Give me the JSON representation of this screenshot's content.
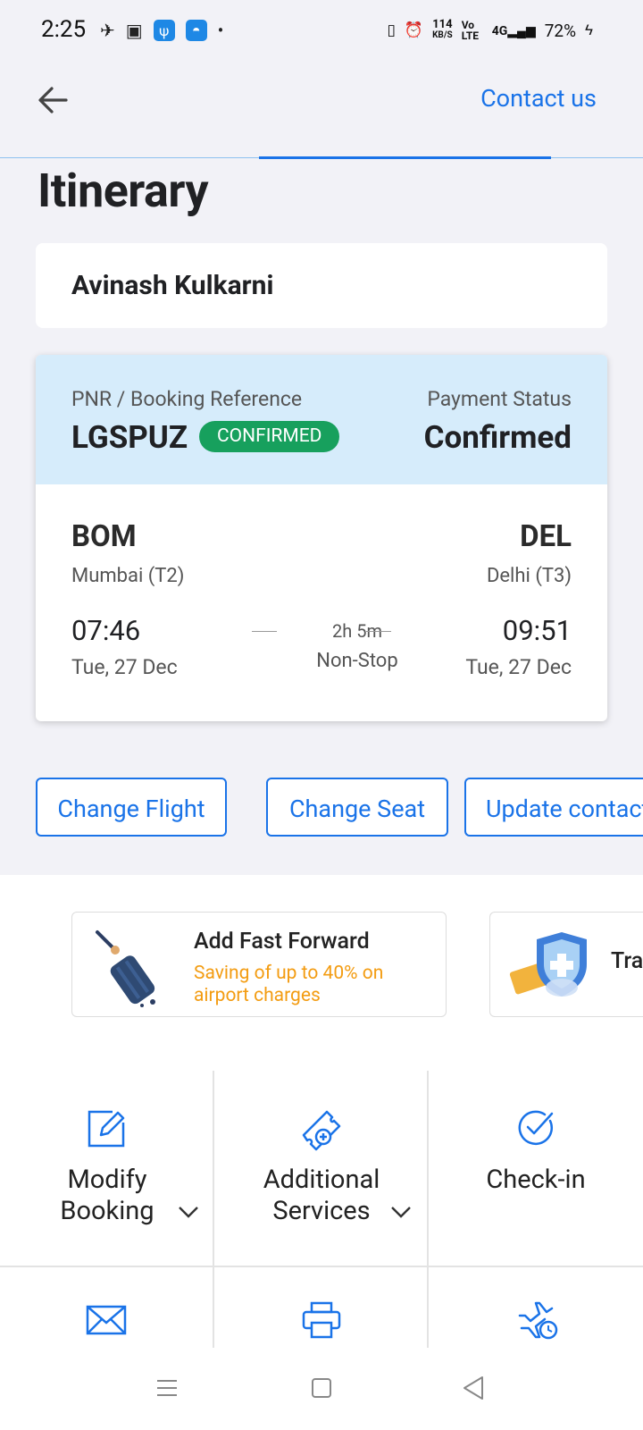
{
  "status_bar": {
    "time": "2:25",
    "network_speed_top": "114",
    "network_speed_unit": "KB/S",
    "volte": "Vo LTE",
    "signal": "4G",
    "battery": "72%"
  },
  "header": {
    "contact_label": "Contact us",
    "title": "Itinerary"
  },
  "passenger": {
    "name": "Avinash Kulkarni"
  },
  "booking": {
    "pnr_label": "PNR / Booking Reference",
    "pnr_code": "LGSPUZ",
    "pnr_status_badge": "CONFIRMED",
    "payment_label": "Payment Status",
    "payment_status": "Confirmed",
    "origin_code": "BOM",
    "origin_city": "Mumbai (T2)",
    "destination_code": "DEL",
    "destination_city": "Delhi (T3)",
    "depart_time": "07:46",
    "depart_date": "Tue, 27 Dec",
    "arrive_time": "09:51",
    "arrive_date": "Tue, 27 Dec",
    "duration": "2h 5m",
    "stops": "Non-Stop"
  },
  "actions": {
    "change_flight": "Change Flight",
    "change_seat": "Change Seat",
    "update_contact": "Update contact"
  },
  "promos": {
    "fast_forward_title": "Add Fast Forward",
    "fast_forward_sub_1": "Saving of up to 40% on",
    "fast_forward_sub_2": "airport charges",
    "travel_title": "Tra"
  },
  "grid": {
    "modify_line1": "Modify",
    "modify_line2": "Booking",
    "additional_line1": "Additional",
    "additional_line2": "Services",
    "checkin": "Check-in"
  },
  "colors": {
    "accent": "#1a73e8",
    "confirmed_green": "#17a05d",
    "booking_header_bg": "#d6ecfb",
    "promo_orange": "#f39c12"
  }
}
